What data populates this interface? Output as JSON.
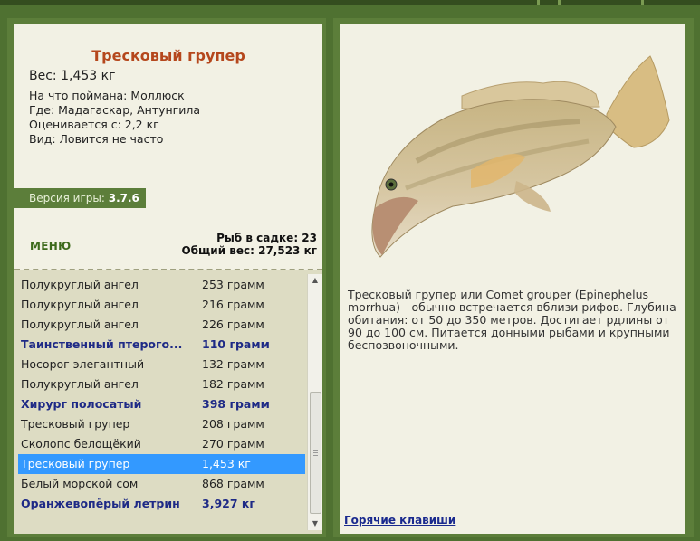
{
  "fish": {
    "name": "Тресковый групер",
    "weight": "Вес: 1,453 кг",
    "caught_on": "На что поймана: Моллюск",
    "location": "Где: Мадагаскар, Антунгила",
    "rated_from": "Оценивается с: 2,2 кг",
    "rarity": "Вид: Ловится не часто",
    "description": "Тресковый групер или Comet grouper (Epinephelus morrhua) - обычно встречается вблизи рифов. Глубина обитания: от 50 до 350 метров. Достигает рдлины от 90 до 100 см. Питается донными рыбами и крупными беспозвоночными."
  },
  "version": {
    "label": "Версия игры:",
    "value": "3.7.6"
  },
  "menu_label": "МЕНЮ",
  "stats": {
    "fish_in_keepnet": "Рыб в садке: 23",
    "total_weight": "Общий вес: 27,523 кг"
  },
  "hotkeys_label": "Горячие клавиши",
  "catch_list": [
    {
      "name": "Полукруглый ангел",
      "weight": "253 грамм",
      "bold": false
    },
    {
      "name": "Полукруглый ангел",
      "weight": "216 грамм",
      "bold": false
    },
    {
      "name": "Полукруглый ангел",
      "weight": "226 грамм",
      "bold": false
    },
    {
      "name": "Таинственный птерого...",
      "weight": "110 грамм",
      "bold": true
    },
    {
      "name": "Носорог элегантный",
      "weight": "132 грамм",
      "bold": false
    },
    {
      "name": "Полукруглый ангел",
      "weight": "182 грамм",
      "bold": false
    },
    {
      "name": "Хирург полосатый",
      "weight": "398 грамм",
      "bold": true
    },
    {
      "name": "Тресковый групер",
      "weight": "208 грамм",
      "bold": false
    },
    {
      "name": "Сколопс белощёкий",
      "weight": "270 грамм",
      "bold": false
    },
    {
      "name": "Тресковый групер",
      "weight": "1,453 кг",
      "bold": false,
      "selected": true
    },
    {
      "name": "Белый морской сом",
      "weight": "868 грамм",
      "bold": false
    },
    {
      "name": "Оранжевопёрый летрин",
      "weight": "3,927 кг",
      "bold": true
    }
  ]
}
